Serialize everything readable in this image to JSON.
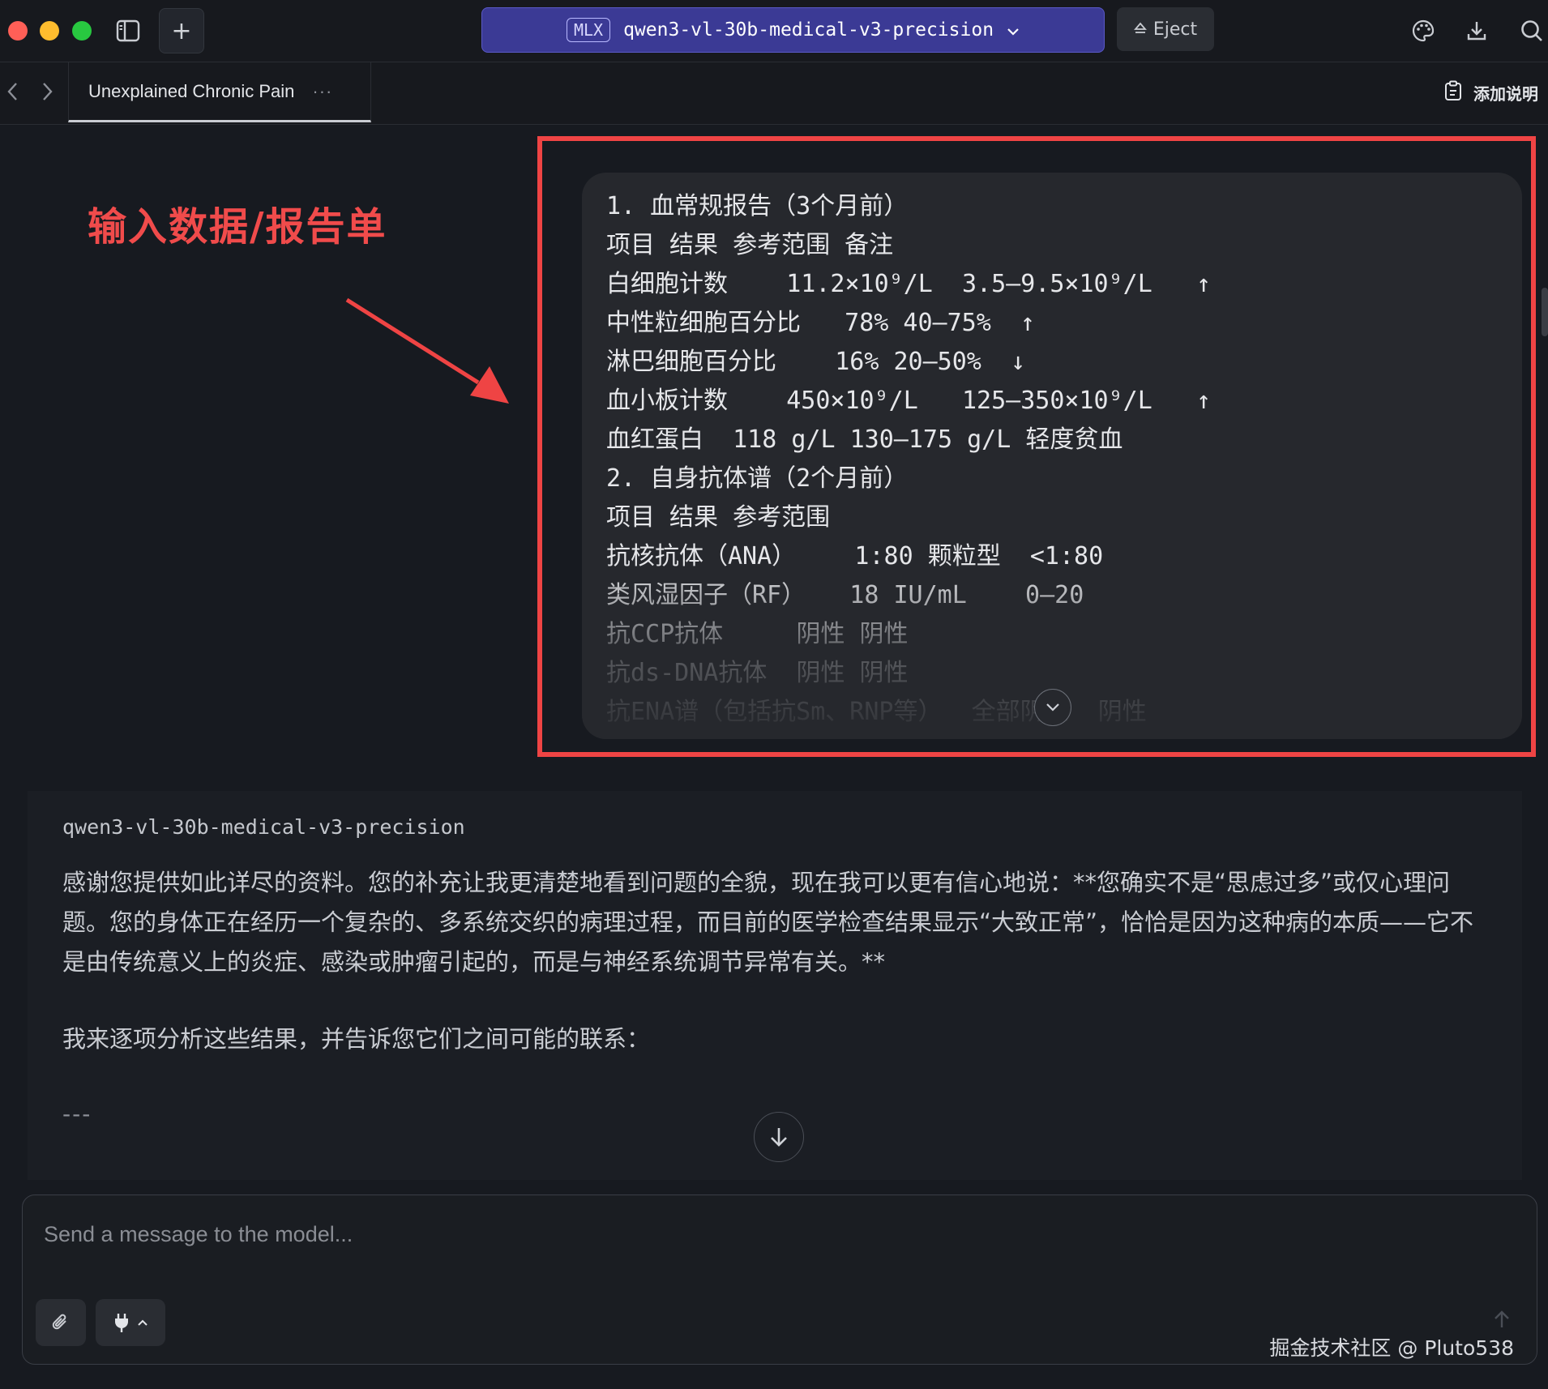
{
  "window": {
    "model_badge": "MLX",
    "model_name": "qwen3-vl-30b-medical-v3-precision",
    "eject_label": "Eject"
  },
  "tab": {
    "title": "Unexplained Chronic Pain",
    "more": "···",
    "notes_label": "添加说明"
  },
  "annotation": {
    "label": "输入数据/报告单"
  },
  "report": {
    "lines": [
      "1. 血常规报告（3个月前）",
      "项目 结果 参考范围 备注",
      "白细胞计数    11.2×10⁹/L  3.5–9.5×10⁹/L   ↑",
      "中性粒细胞百分比   78% 40–75%  ↑",
      "淋巴细胞百分比    16% 20–50%  ↓",
      "血小板计数    450×10⁹/L   125–350×10⁹/L   ↑",
      "血红蛋白  118 g/L 130–175 g/L 轻度贫血",
      "2. 自身抗体谱（2个月前）",
      "项目 结果 参考范围",
      "抗核抗体（ANA）    1:80 颗粒型  <1:80",
      "类风湿因子（RF）   18 IU/mL    0–20",
      "抗CCP抗体     阴性 阴性",
      "抗ds-DNA抗体  阴性 阴性",
      "抗ENA谱（包括抗Sm、RNP等）  全部阴性  阴性"
    ]
  },
  "assistant": {
    "model_name": "qwen3-vl-30b-medical-v3-precision",
    "paragraph1": "感谢您提供如此详尽的资料。您的补充让我更清楚地看到问题的全貌，现在我可以更有信心地说：**您确实不是“思虑过多”或仅心理问题。您的身体正在经历一个复杂的、多系统交织的病理过程，而目前的医学检查结果显示“大致正常”，恰恰是因为这种病的本质——它不是由传统意义上的炎症、感染或肿瘤引起的，而是与神经系统调节异常有关。**",
    "paragraph2": "我来逐项分析这些结果，并告诉您它们之间可能的联系：",
    "separator": "---"
  },
  "composer": {
    "placeholder": "Send a message to the model..."
  },
  "watermark": "掘金技术社区 @ Pluto538",
  "colors": {
    "accent_model": "#3b3a95",
    "annotation_red": "#ef4444",
    "background": "#171a20"
  }
}
